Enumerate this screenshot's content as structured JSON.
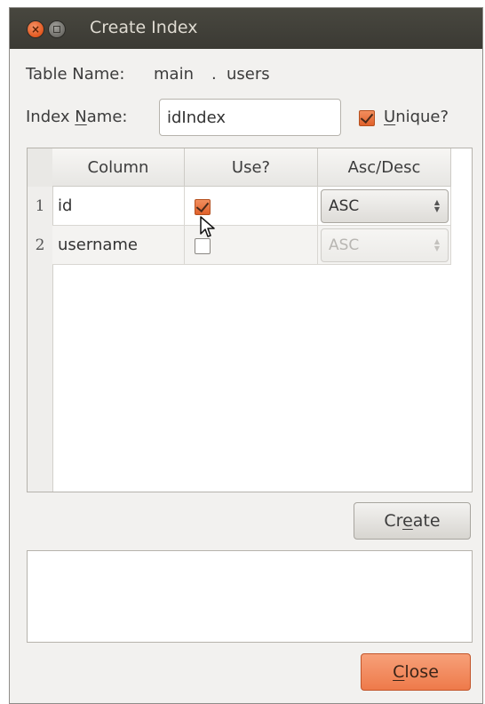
{
  "window": {
    "title": "Create Index",
    "close_glyph": "×"
  },
  "form": {
    "table_name_label": "Table Name:",
    "schema": "main",
    "separator": ".",
    "table": "users",
    "index_name_label_pre": "Index ",
    "index_name_label_key": "N",
    "index_name_label_post": "ame:",
    "index_name_value": "idIndex",
    "unique_key": "U",
    "unique_rest": "nique?",
    "unique_checked": true
  },
  "table": {
    "headers": [
      "Column",
      "Use?",
      "Asc/Desc"
    ],
    "rows": [
      {
        "num": "1",
        "column": "id",
        "use": true,
        "order": "ASC",
        "order_enabled": true
      },
      {
        "num": "2",
        "column": "username",
        "use": false,
        "order": "ASC",
        "order_enabled": false
      }
    ]
  },
  "buttons": {
    "create_pre": "Cr",
    "create_key": "e",
    "create_post": "ate",
    "close_key": "C",
    "close_post": "lose"
  },
  "icons": {
    "close": "close-icon",
    "minimize": "minimize-icon",
    "checkbox": "checkbox-icon",
    "spinner": "updown-arrows-icon",
    "cursor": "mouse-pointer-icon"
  },
  "colors": {
    "accent": "#ee7a4a",
    "titlebar": "#3b3a34",
    "window_bg": "#f2f1ef"
  }
}
